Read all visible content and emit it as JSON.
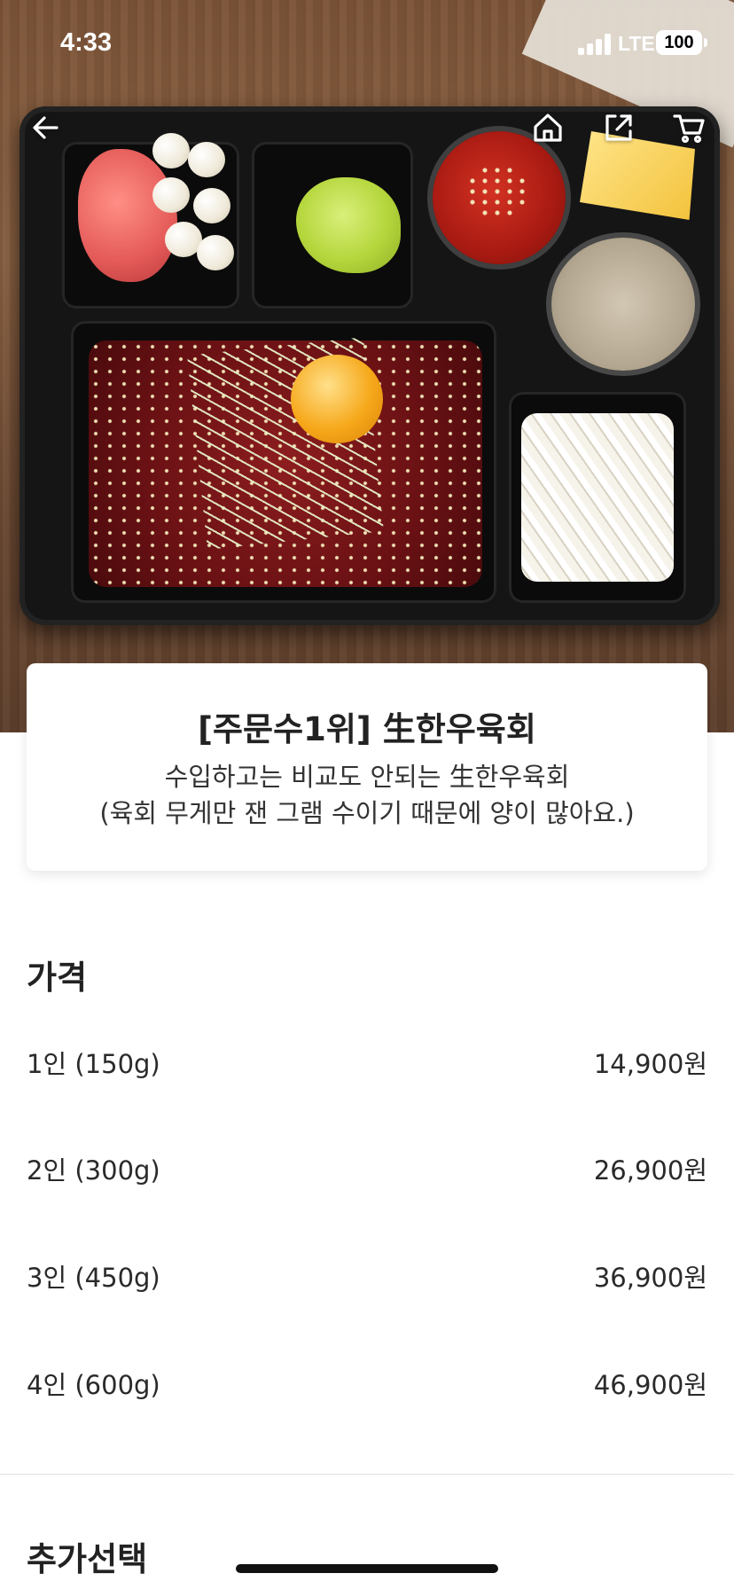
{
  "status_bar": {
    "time": "4:33",
    "network": "LTE",
    "battery": "100"
  },
  "nav": {
    "back_icon": "arrow-left-icon",
    "home_icon": "home-icon",
    "share_icon": "share-icon",
    "cart_icon": "cart-icon"
  },
  "product": {
    "title": "[주문수1위] 生한우육회",
    "description_line1": "수입하고는 비교도 안되는 生한우육회",
    "description_line2": "(육회 무게만 잰 그램 수이기 때문에 양이 많아요.)"
  },
  "price_section": {
    "title": "가격",
    "options": [
      {
        "label": "1인 (150g)",
        "price": "14,900원"
      },
      {
        "label": "2인 (300g)",
        "price": "26,900원"
      },
      {
        "label": "3인 (450g)",
        "price": "36,900원"
      },
      {
        "label": "4인 (600g)",
        "price": "46,900원"
      }
    ]
  },
  "extra_section": {
    "title": "추가선택"
  },
  "colors": {
    "background": "#ffffff",
    "text": "#222222",
    "divider": "#e2e2e2"
  }
}
